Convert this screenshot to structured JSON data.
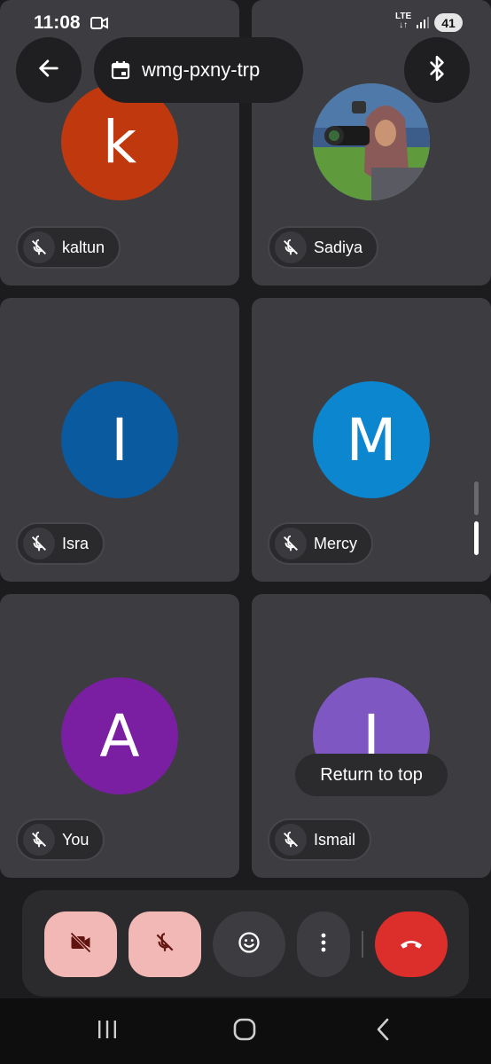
{
  "status": {
    "time": "11:08",
    "network_top": "LTE",
    "network_bottom": "↓↑",
    "battery": "41"
  },
  "header": {
    "meeting_code": "wmg-pxny-trp",
    "back_icon": "arrow-left-icon",
    "calendar_icon": "calendar-icon",
    "bluetooth_icon": "bluetooth-icon"
  },
  "participants": [
    {
      "name": "kaltun",
      "initial": "k",
      "color": "#c0380e"
    },
    {
      "name": "Sadiya",
      "initial": "",
      "color": "#4a6a8a"
    },
    {
      "name": "Isra",
      "initial": "I",
      "color": "#0a5aa0"
    },
    {
      "name": "Mercy",
      "initial": "M",
      "color": "#0b86cf"
    },
    {
      "name": "You",
      "initial": "A",
      "color": "#7a1fa2"
    },
    {
      "name": "Ismail",
      "initial": "I",
      "color": "#7e57c2"
    }
  ],
  "overlay": {
    "return_to_top": "Return to top"
  },
  "controls": {
    "camera_off_icon": "video-off-icon",
    "mic_off_icon": "mic-off-icon",
    "reactions_icon": "emoji-icon",
    "more_icon": "more-vert-icon",
    "hangup_icon": "call-end-icon",
    "camera_bg": "#f2b8b5",
    "mic_bg": "#f2b8b5",
    "neutral_bg": "#3c3c41",
    "hangup_bg": "#dc2e2a"
  },
  "nav": {
    "recents_icon": "recents-icon",
    "home_icon": "home-icon",
    "back_icon": "back-chevron-icon"
  }
}
